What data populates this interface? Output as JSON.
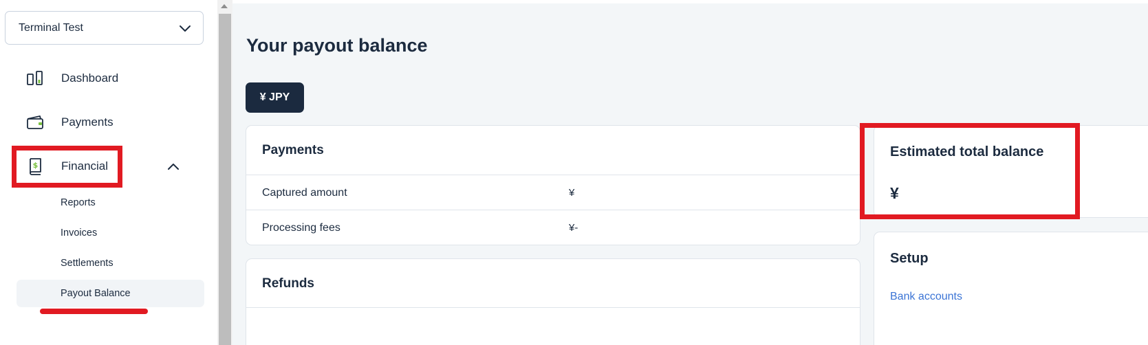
{
  "sidebar": {
    "account_select": {
      "value": "Terminal Test",
      "icon": "chevron-down-icon"
    },
    "nav": [
      {
        "label": "Dashboard",
        "icon": "dashboard-icon"
      },
      {
        "label": "Payments",
        "icon": "wallet-icon"
      },
      {
        "label": "Financial",
        "icon": "financial-book-icon",
        "expanded": true
      }
    ],
    "financial_sub": [
      {
        "label": "Reports"
      },
      {
        "label": "Invoices"
      },
      {
        "label": "Settlements"
      },
      {
        "label": "Payout Balance",
        "active": true
      }
    ]
  },
  "main": {
    "title": "Your payout balance",
    "currency_button": "¥ JPY",
    "payments_card": {
      "title": "Payments",
      "rows": [
        {
          "label": "Captured amount",
          "value": "¥"
        },
        {
          "label": "Processing fees",
          "value": "¥-"
        }
      ]
    },
    "refunds_card": {
      "title": "Refunds"
    },
    "balance_card": {
      "title": "Estimated total balance",
      "value": "¥"
    },
    "setup_card": {
      "title": "Setup",
      "link": "Bank accounts"
    }
  },
  "colors": {
    "highlight": "#e11a22",
    "navy": "#1b2a3f",
    "link": "#3b74d5",
    "accent_green": "#7cc242"
  }
}
